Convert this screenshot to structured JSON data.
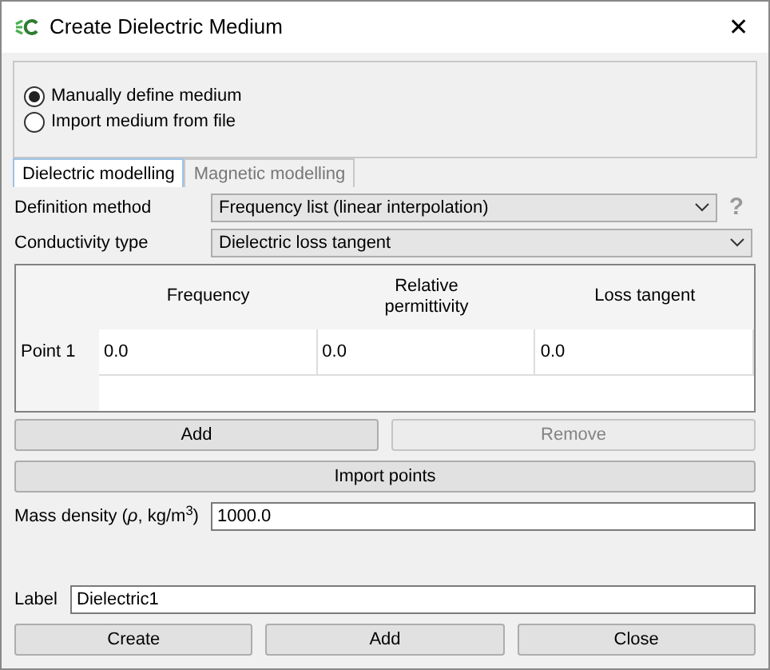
{
  "window": {
    "title": "Create Dielectric Medium",
    "close": "✕"
  },
  "source_options": [
    {
      "label": "Manually define medium",
      "selected": true
    },
    {
      "label": "Import medium from file",
      "selected": false
    }
  ],
  "tabs": [
    {
      "label": "Dielectric modelling",
      "selected": true
    },
    {
      "label": "Magnetic modelling",
      "selected": false
    }
  ],
  "fields": [
    {
      "label": "Definition method",
      "value": "Frequency list (linear interpolation)",
      "help": "?"
    },
    {
      "label": "Conductivity type",
      "value": "Dielectric loss tangent"
    }
  ],
  "table": {
    "columns": [
      "Frequency",
      "Relative permittivity",
      "Loss tangent"
    ],
    "rows": [
      {
        "header": "Point 1",
        "cells": [
          "0.0",
          "0.0",
          "0.0"
        ]
      }
    ]
  },
  "point_buttons": [
    {
      "label": "Add",
      "disabled": false
    },
    {
      "label": "Remove",
      "disabled": true
    }
  ],
  "import_button": "Import points",
  "mass_density": {
    "label": "Mass density (*ρ*, kg/m$^{3}$)",
    "value": "1000.0"
  },
  "label_field": {
    "label": "Label",
    "value": "Dielectric1"
  },
  "buttons": [
    "Create",
    "Add",
    "Close"
  ]
}
